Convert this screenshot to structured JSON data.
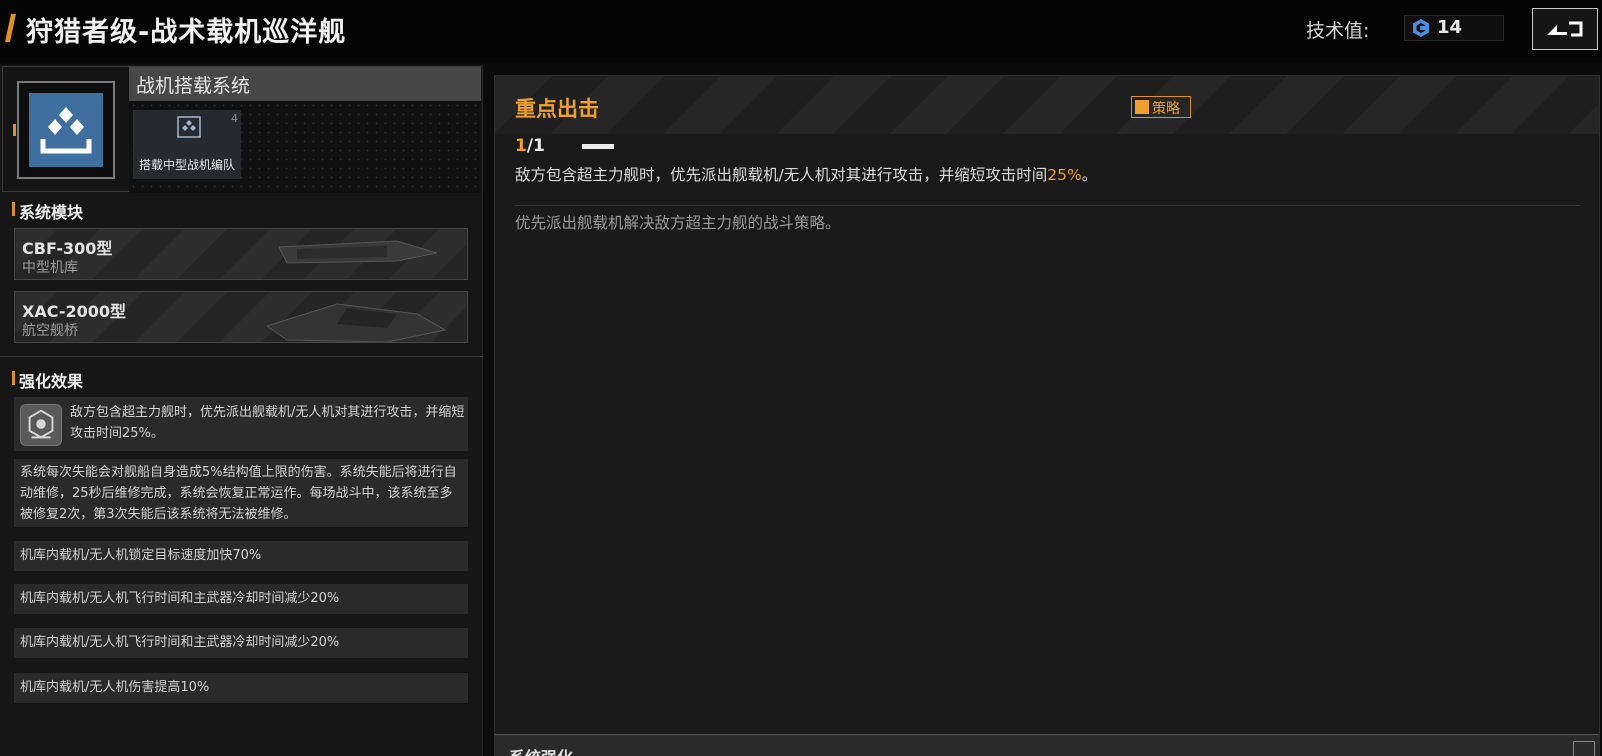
{
  "header": {
    "title": "狩猎者级-战术载机巡洋舰",
    "tech_label": "技术值:",
    "tech_value": "14"
  },
  "carrier_system": {
    "title": "战机搭载系统",
    "squad": {
      "count": "4",
      "label": "搭载中型战机编队"
    }
  },
  "modules": {
    "title": "系统模块",
    "items": [
      {
        "name": "CBF-300型",
        "type": "中型机库"
      },
      {
        "name": "XAC-2000型",
        "type": "航空舰桥"
      }
    ]
  },
  "effects": {
    "title": "强化效果",
    "items": [
      {
        "text": "敌方包含超主力舰时，优先派出舰载机/无人机对其进行攻击，并缩短攻击时间25%。"
      },
      {
        "text": "系统每次失能会对舰船自身造成5%结构值上限的伤害。系统失能后将进行自动维修，25秒后维修完成，系统会恢复正常运作。每场战斗中，该系统至多被修复2次，第3次失能后该系统将无法被维修。"
      },
      {
        "text": "机库内载机/无人机锁定目标速度加快70%"
      },
      {
        "text": "机库内载机/无人机飞行时间和主武器冷却时间减少20%"
      },
      {
        "text": "机库内载机/无人机飞行时间和主武器冷却时间减少20%"
      },
      {
        "text": "机库内载机/无人机伤害提高10%"
      }
    ]
  },
  "detail": {
    "title": "重点出击",
    "badge": "策略",
    "page_current": "1",
    "page_total": "/1",
    "desc_before": "敌方包含超主力舰时，优先派出舰载机/无人机对其进行攻击，并缩短攻击时间",
    "desc_highlight": "25%",
    "desc_after": "。",
    "desc_sub": "优先派出舰载机解决敌方超主力舰的战斗策略。",
    "footer_title": "系统强化"
  },
  "colors": {
    "accent": "#f0a030",
    "icon_blue": "#3f6f9f"
  }
}
